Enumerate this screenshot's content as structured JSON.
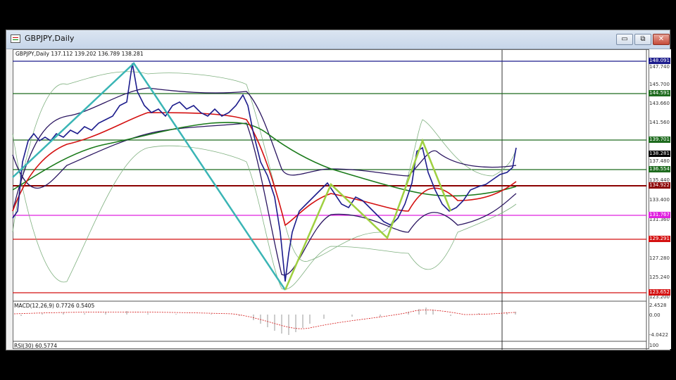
{
  "window": {
    "title": "GBPJPY,Daily",
    "minimize": "▭",
    "restore": "⧉",
    "close": "✕"
  },
  "header": {
    "symbol": "GBPJPY,Daily",
    "ohlc": "137.112 139.202 136.789 138.281"
  },
  "price_axis": [
    "147.740",
    "145.700",
    "143.660",
    "141.560",
    "137.480",
    "135.440",
    "133.400",
    "131.360",
    "127.280",
    "125.240",
    "123.200"
  ],
  "levels": [
    {
      "value": "148.091",
      "color": "#1c1c8c"
    },
    {
      "value": "144.591",
      "color": "#1e6b1e"
    },
    {
      "value": "139.701",
      "color": "#1e6b1e"
    },
    {
      "value": "138.281",
      "color": "#000000"
    },
    {
      "value": "136.554",
      "color": "#1e6b1e"
    },
    {
      "value": "134.922",
      "color": "#8b0000"
    },
    {
      "value": "131.767",
      "color": "#e020e0"
    },
    {
      "value": "129.291",
      "color": "#d41010"
    },
    {
      "value": "123.652",
      "color": "#d41010"
    }
  ],
  "macd": {
    "label": "MACD(12,26,9) 0.7726 0.5405",
    "scale": [
      "2.4528",
      "0.00",
      "-4.0422"
    ]
  },
  "rsi": {
    "label": "RSI(30) 60.5774",
    "scale": [
      "100"
    ]
  }
}
